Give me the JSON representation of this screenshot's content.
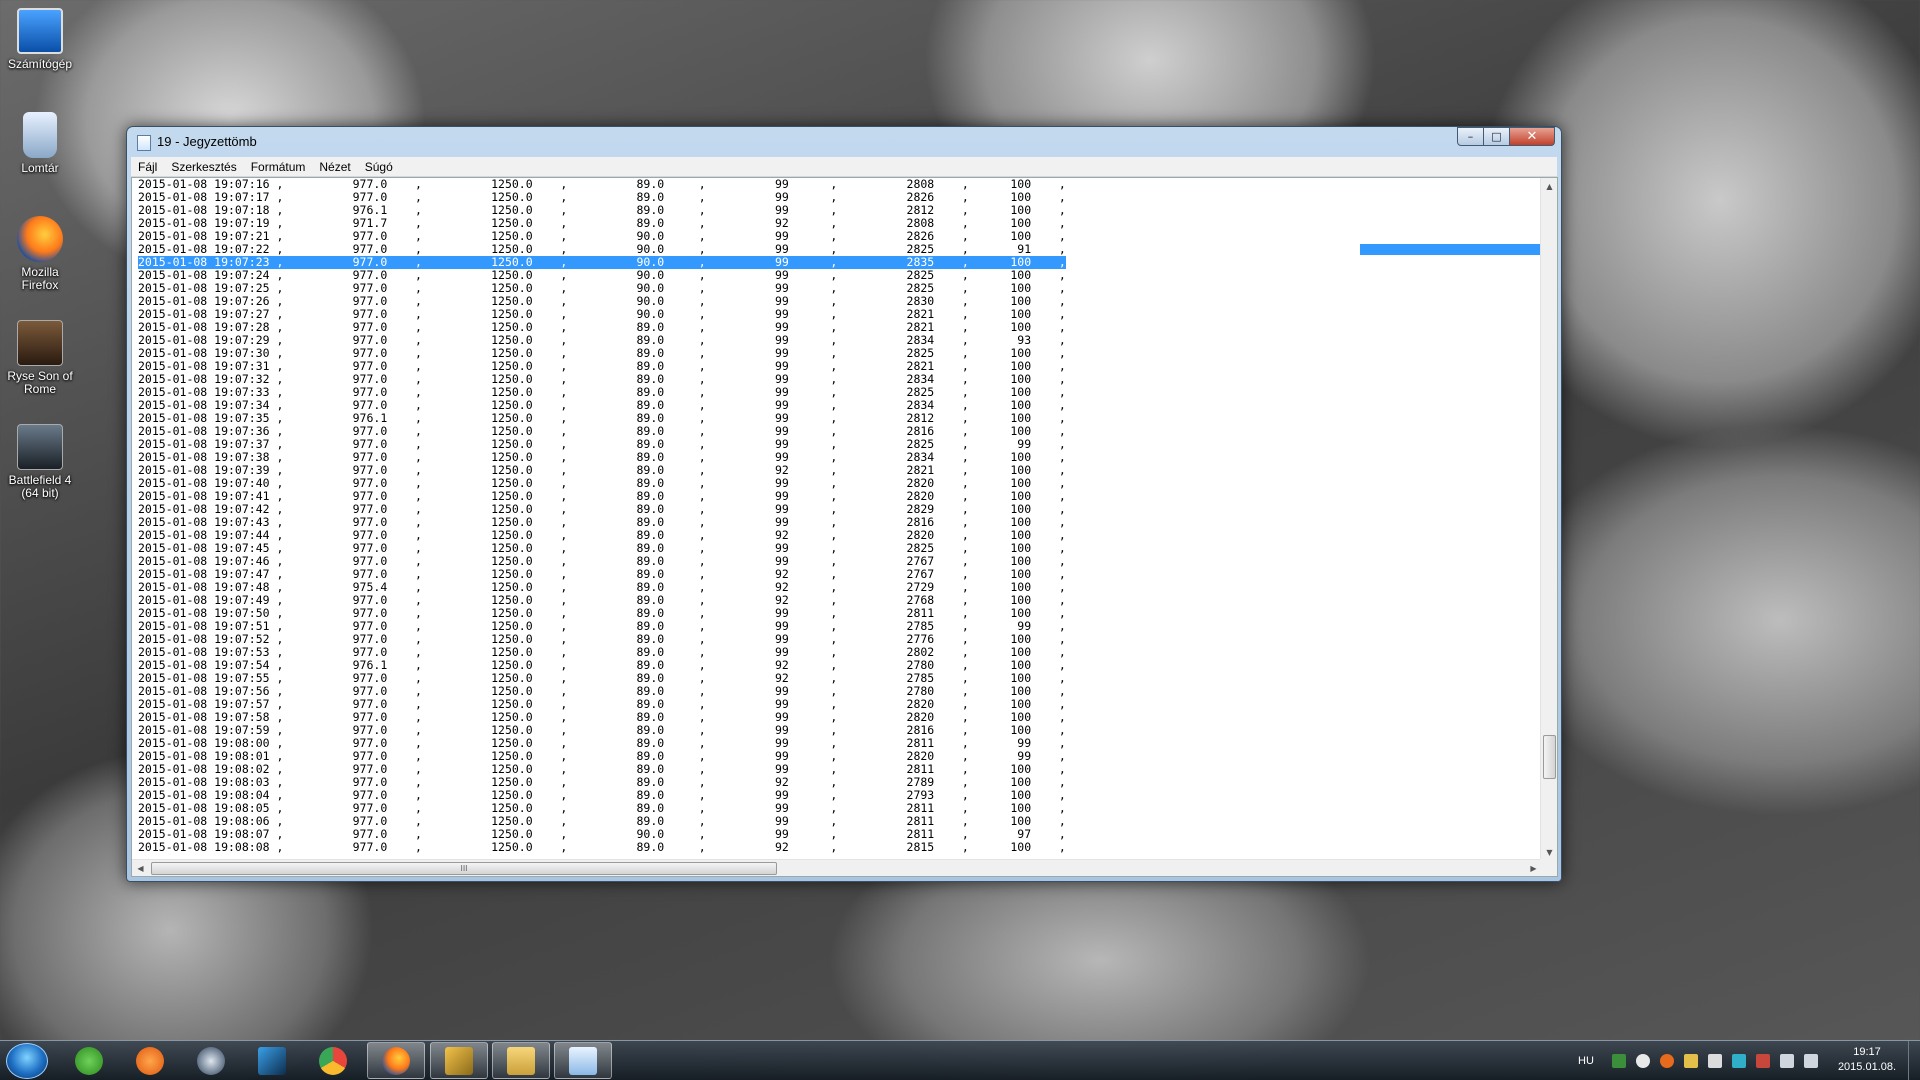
{
  "desktop": {
    "icons": [
      {
        "label": "Számítógép",
        "icon": "computer-icon"
      },
      {
        "label": "Lomtár",
        "icon": "recycle-bin-icon"
      },
      {
        "label": "Mozilla Firefox",
        "icon": "firefox-icon"
      },
      {
        "label": "Ryse Son of Rome",
        "icon": "ryse-icon"
      },
      {
        "label": "Battlefield 4 (64 bit)",
        "icon": "battlefield-icon"
      }
    ]
  },
  "window": {
    "title": "19 - Jegyzettömb",
    "menu": [
      "Fájl",
      "Szerkesztés",
      "Formátum",
      "Nézet",
      "Súgó"
    ],
    "selected_index": 6,
    "lines": [
      "2015-01-08 19:07:16 ,          977.0    ,          1250.0    ,          89.0     ,          99      ,          2808    ,      100    ,",
      "2015-01-08 19:07:17 ,          977.0    ,          1250.0    ,          89.0     ,          99      ,          2826    ,      100    ,",
      "2015-01-08 19:07:18 ,          976.1    ,          1250.0    ,          89.0     ,          99      ,          2812    ,      100    ,",
      "2015-01-08 19:07:19 ,          971.7    ,          1250.0    ,          89.0     ,          92      ,          2808    ,      100    ,",
      "2015-01-08 19:07:21 ,          977.0    ,          1250.0    ,          90.0     ,          99      ,          2826    ,      100    ,",
      "2015-01-08 19:07:22 ,          977.0    ,          1250.0    ,          90.0     ,          99      ,          2825    ,       91    ,",
      "2015-01-08 19:07:23 ,          977.0    ,          1250.0    ,          90.0     ,          99      ,          2835    ,      100    ,",
      "2015-01-08 19:07:24 ,          977.0    ,          1250.0    ,          90.0     ,          99      ,          2825    ,      100    ,",
      "2015-01-08 19:07:25 ,          977.0    ,          1250.0    ,          90.0     ,          99      ,          2825    ,      100    ,",
      "2015-01-08 19:07:26 ,          977.0    ,          1250.0    ,          90.0     ,          99      ,          2830    ,      100    ,",
      "2015-01-08 19:07:27 ,          977.0    ,          1250.0    ,          90.0     ,          99      ,          2821    ,      100    ,",
      "2015-01-08 19:07:28 ,          977.0    ,          1250.0    ,          89.0     ,          99      ,          2821    ,      100    ,",
      "2015-01-08 19:07:29 ,          977.0    ,          1250.0    ,          89.0     ,          99      ,          2834    ,       93    ,",
      "2015-01-08 19:07:30 ,          977.0    ,          1250.0    ,          89.0     ,          99      ,          2825    ,      100    ,",
      "2015-01-08 19:07:31 ,          977.0    ,          1250.0    ,          89.0     ,          99      ,          2821    ,      100    ,",
      "2015-01-08 19:07:32 ,          977.0    ,          1250.0    ,          89.0     ,          99      ,          2834    ,      100    ,",
      "2015-01-08 19:07:33 ,          977.0    ,          1250.0    ,          89.0     ,          99      ,          2825    ,      100    ,",
      "2015-01-08 19:07:34 ,          977.0    ,          1250.0    ,          89.0     ,          99      ,          2834    ,      100    ,",
      "2015-01-08 19:07:35 ,          976.1    ,          1250.0    ,          89.0     ,          99      ,          2812    ,      100    ,",
      "2015-01-08 19:07:36 ,          977.0    ,          1250.0    ,          89.0     ,          99      ,          2816    ,      100    ,",
      "2015-01-08 19:07:37 ,          977.0    ,          1250.0    ,          89.0     ,          99      ,          2825    ,       99    ,",
      "2015-01-08 19:07:38 ,          977.0    ,          1250.0    ,          89.0     ,          99      ,          2834    ,      100    ,",
      "2015-01-08 19:07:39 ,          977.0    ,          1250.0    ,          89.0     ,          92      ,          2821    ,      100    ,",
      "2015-01-08 19:07:40 ,          977.0    ,          1250.0    ,          89.0     ,          99      ,          2820    ,      100    ,",
      "2015-01-08 19:07:41 ,          977.0    ,          1250.0    ,          89.0     ,          99      ,          2820    ,      100    ,",
      "2015-01-08 19:07:42 ,          977.0    ,          1250.0    ,          89.0     ,          99      ,          2829    ,      100    ,",
      "2015-01-08 19:07:43 ,          977.0    ,          1250.0    ,          89.0     ,          99      ,          2816    ,      100    ,",
      "2015-01-08 19:07:44 ,          977.0    ,          1250.0    ,          89.0     ,          92      ,          2820    ,      100    ,",
      "2015-01-08 19:07:45 ,          977.0    ,          1250.0    ,          89.0     ,          99      ,          2825    ,      100    ,",
      "2015-01-08 19:07:46 ,          977.0    ,          1250.0    ,          89.0     ,          99      ,          2767    ,      100    ,",
      "2015-01-08 19:07:47 ,          977.0    ,          1250.0    ,          89.0     ,          92      ,          2767    ,      100    ,",
      "2015-01-08 19:07:48 ,          975.4    ,          1250.0    ,          89.0     ,          92      ,          2729    ,      100    ,",
      "2015-01-08 19:07:49 ,          977.0    ,          1250.0    ,          89.0     ,          92      ,          2768    ,      100    ,",
      "2015-01-08 19:07:50 ,          977.0    ,          1250.0    ,          89.0     ,          99      ,          2811    ,      100    ,",
      "2015-01-08 19:07:51 ,          977.0    ,          1250.0    ,          89.0     ,          99      ,          2785    ,       99    ,",
      "2015-01-08 19:07:52 ,          977.0    ,          1250.0    ,          89.0     ,          99      ,          2776    ,      100    ,",
      "2015-01-08 19:07:53 ,          977.0    ,          1250.0    ,          89.0     ,          99      ,          2802    ,      100    ,",
      "2015-01-08 19:07:54 ,          976.1    ,          1250.0    ,          89.0     ,          92      ,          2780    ,      100    ,",
      "2015-01-08 19:07:55 ,          977.0    ,          1250.0    ,          89.0     ,          92      ,          2785    ,      100    ,",
      "2015-01-08 19:07:56 ,          977.0    ,          1250.0    ,          89.0     ,          99      ,          2780    ,      100    ,",
      "2015-01-08 19:07:57 ,          977.0    ,          1250.0    ,          89.0     ,          99      ,          2820    ,      100    ,",
      "2015-01-08 19:07:58 ,          977.0    ,          1250.0    ,          89.0     ,          99      ,          2820    ,      100    ,",
      "2015-01-08 19:07:59 ,          977.0    ,          1250.0    ,          89.0     ,          99      ,          2816    ,      100    ,",
      "2015-01-08 19:08:00 ,          977.0    ,          1250.0    ,          89.0     ,          99      ,          2811    ,       99    ,",
      "2015-01-08 19:08:01 ,          977.0    ,          1250.0    ,          89.0     ,          99      ,          2820    ,       99    ,",
      "2015-01-08 19:08:02 ,          977.0    ,          1250.0    ,          89.0     ,          99      ,          2811    ,      100    ,",
      "2015-01-08 19:08:03 ,          977.0    ,          1250.0    ,          89.0     ,          92      ,          2789    ,      100    ,",
      "2015-01-08 19:08:04 ,          977.0    ,          1250.0    ,          89.0     ,          99      ,          2793    ,      100    ,",
      "2015-01-08 19:08:05 ,          977.0    ,          1250.0    ,          89.0     ,          99      ,          2811    ,      100    ,",
      "2015-01-08 19:08:06 ,          977.0    ,          1250.0    ,          89.0     ,          99      ,          2811    ,      100    ,",
      "2015-01-08 19:08:07 ,          977.0    ,          1250.0    ,          90.0     ,          99      ,          2811    ,       97    ,",
      "2015-01-08 19:08:08 ,          977.0    ,          1250.0    ,          89.0     ,          92      ,          2815    ,      100    ,"
    ],
    "hscroll_grip": "III"
  },
  "taskbar": {
    "apps": [
      {
        "icon": "utorrent-icon"
      },
      {
        "icon": "origin-icon"
      },
      {
        "icon": "steam-icon"
      },
      {
        "icon": "battlefield-taskbar-icon"
      },
      {
        "icon": "chrome-icon"
      },
      {
        "icon": "firefox-icon"
      },
      {
        "icon": "tool-icon"
      },
      {
        "icon": "explorer-icon"
      },
      {
        "icon": "notepad-icon"
      }
    ],
    "language": "HU",
    "time": "19:17",
    "date": "2015.01.08."
  }
}
